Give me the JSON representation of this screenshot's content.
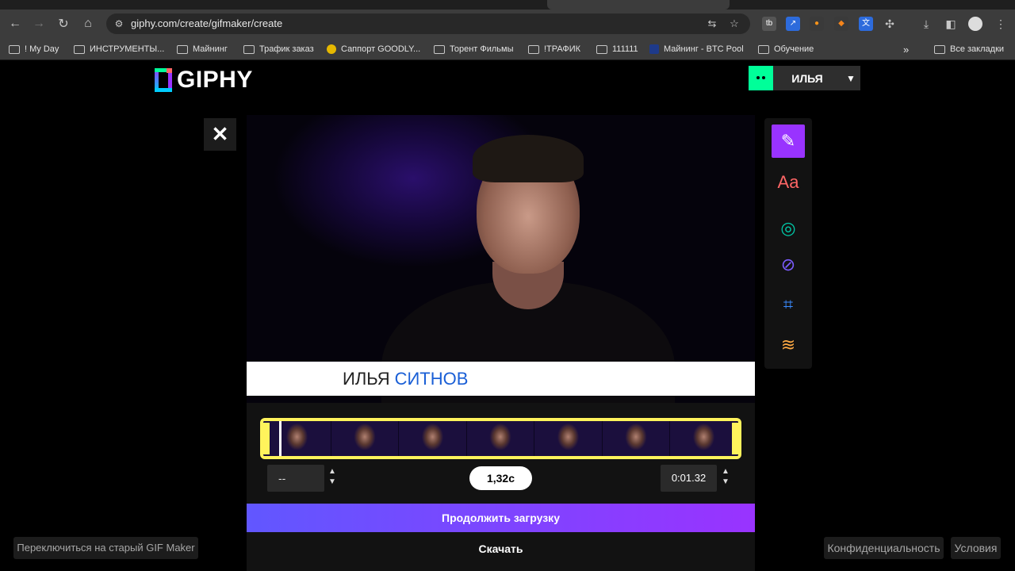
{
  "browser": {
    "url": "giphy.com/create/gifmaker/create",
    "bookmarks": [
      {
        "label": "! My Day",
        "icon": "folder-icon"
      },
      {
        "label": "ИНСТРУМЕНТЫ...",
        "icon": "folder-icon"
      },
      {
        "label": "Майнинг",
        "icon": "folder-icon"
      },
      {
        "label": "Трафик заказ",
        "icon": "folder-icon"
      },
      {
        "label": "Саппорт GOODLY...",
        "icon": "site-icon"
      },
      {
        "label": "Торент Фильмы",
        "icon": "folder-icon"
      },
      {
        "label": "!ТРАФИК",
        "icon": "folder-icon"
      },
      {
        "label": "111111",
        "icon": "folder-icon"
      },
      {
        "label": "Майнинг - BTC Pool",
        "icon": "site-icon"
      },
      {
        "label": "Обучение",
        "icon": "folder-icon"
      }
    ],
    "all_bookmarks_label": "Все закладки"
  },
  "header": {
    "logo_text": "GIPHY",
    "user_name": "ИЛЬЯ"
  },
  "caption": {
    "first_name": "ИЛЬЯ",
    "last_name": "СИТНОВ"
  },
  "tools": [
    {
      "name": "draw",
      "icon": "pencil-icon",
      "glyph": "✎"
    },
    {
      "name": "text",
      "icon": "text-icon",
      "glyph": "Aa"
    },
    {
      "name": "stickers",
      "icon": "stickers-icon",
      "glyph": "◎"
    },
    {
      "name": "filters",
      "icon": "filter-icon",
      "glyph": "⊘"
    },
    {
      "name": "crop",
      "icon": "crop-icon",
      "glyph": "⌗"
    },
    {
      "name": "layers",
      "icon": "layers-icon",
      "glyph": "≋"
    }
  ],
  "trim": {
    "start_time": "--",
    "duration": "1,32с",
    "end_time": "0:01.32"
  },
  "actions": {
    "continue_label": "Продолжить загрузку",
    "download_label": "Скачать"
  },
  "footer": {
    "legacy_label": "Переключиться на старый GIF Maker",
    "privacy_label": "Конфиденциальность",
    "terms_label": "Условия"
  },
  "colors": {
    "brand_purple": "#9933ff",
    "brand_green": "#00ff99",
    "timeline_border": "#fff35c",
    "caption_accent": "#1a5fd6"
  }
}
